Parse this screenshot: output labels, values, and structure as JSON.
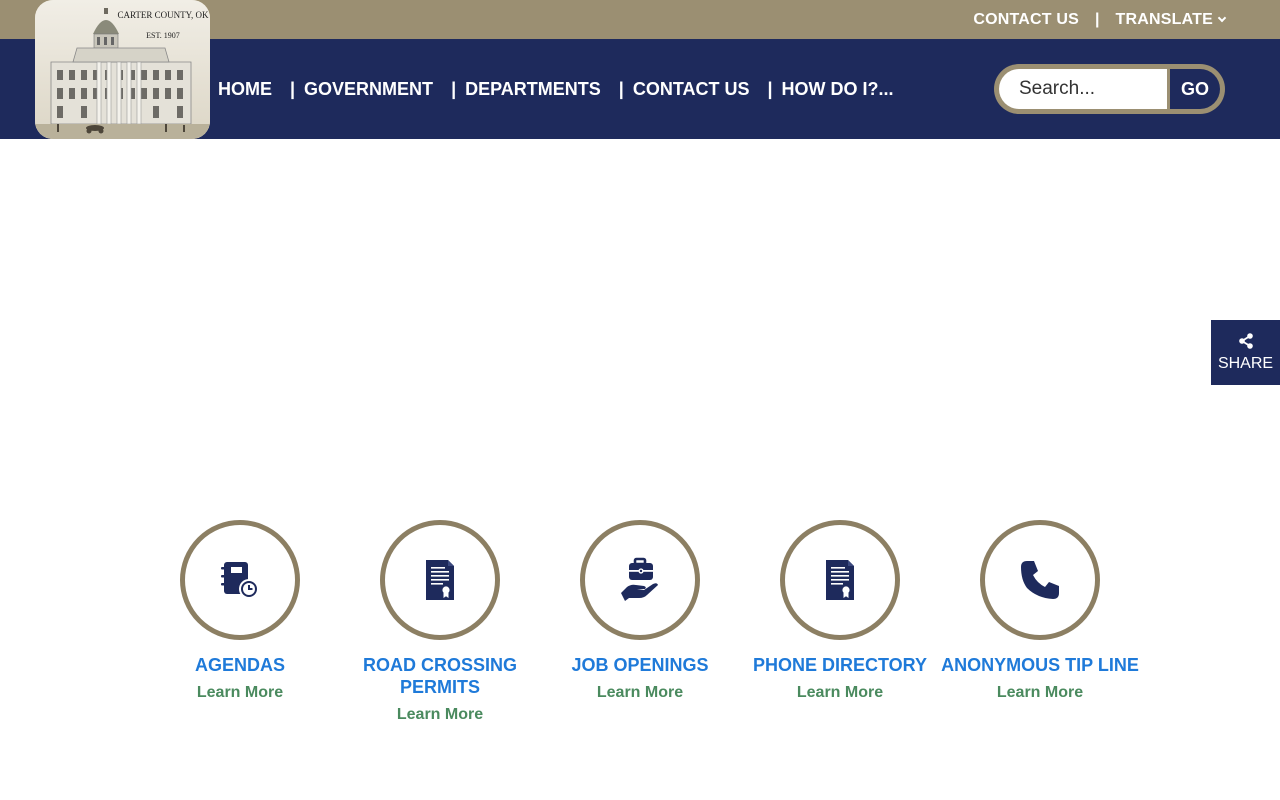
{
  "topbar": {
    "contact_label": "CONTACT US",
    "separator": "|",
    "translate_label": "TRANSLATE"
  },
  "logo": {
    "line1": "CARTER COUNTY, OK",
    "line2": "EST. 1907"
  },
  "nav": {
    "items": [
      {
        "label": "HOME"
      },
      {
        "label": "GOVERNMENT"
      },
      {
        "label": "DEPARTMENTS"
      },
      {
        "label": "CONTACT US"
      },
      {
        "label": "HOW DO I?..."
      }
    ],
    "separator": "|"
  },
  "search": {
    "placeholder": "Search...",
    "button_label": "GO"
  },
  "share": {
    "label": "SHARE",
    "icon": "share-icon"
  },
  "quick_links": [
    {
      "title": "AGENDAS",
      "more": "Learn More",
      "icon": "agenda-clock-icon"
    },
    {
      "title": "ROAD CROSSING PERMITS",
      "more": "Learn More",
      "icon": "certificate-document-icon"
    },
    {
      "title": "JOB OPENINGS",
      "more": "Learn More",
      "icon": "briefcase-hand-icon"
    },
    {
      "title": "PHONE DIRECTORY",
      "more": "Learn More",
      "icon": "certificate-document-icon"
    },
    {
      "title": "ANONYMOUS TIP LINE",
      "more": "Learn More",
      "icon": "phone-icon"
    }
  ],
  "colors": {
    "topbar": "#9b8f72",
    "navbar": "#1e2a5c",
    "circle_border": "#8c7f63",
    "link_blue": "#1f7ad9",
    "learn_more_green": "#4a8a5e"
  }
}
